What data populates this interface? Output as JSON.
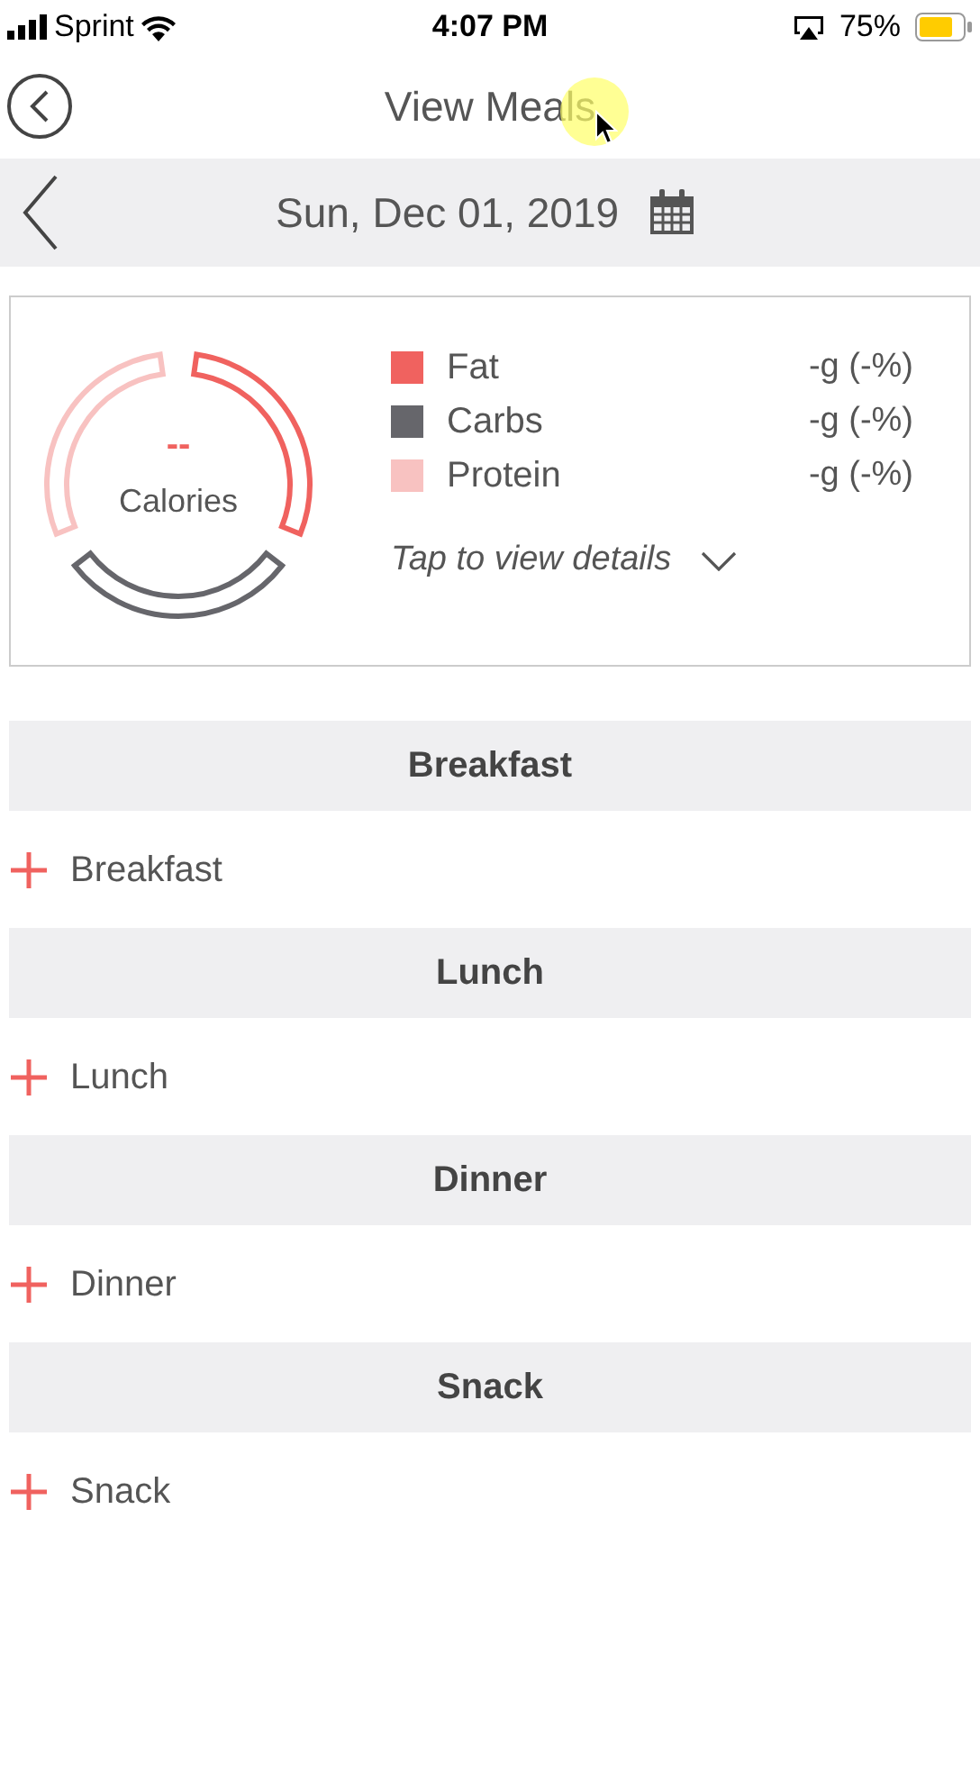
{
  "status_bar": {
    "carrier": "Sprint",
    "time": "4:07 PM",
    "battery": "75%"
  },
  "header": {
    "title": "View Meals"
  },
  "date_bar": {
    "date": "Sun, Dec 01, 2019"
  },
  "summary": {
    "calories_value": "--",
    "calories_label": "Calories",
    "macros": [
      {
        "name": "Fat",
        "value": "-g (-%)",
        "color": "#f0625f"
      },
      {
        "name": "Carbs",
        "value": "-g (-%)",
        "color": "#66666b"
      },
      {
        "name": "Protein",
        "value": "-g (-%)",
        "color": "#f8c2c1"
      }
    ],
    "details_link": "Tap to view details"
  },
  "meals": [
    {
      "heading": "Breakfast",
      "add_label": "Breakfast"
    },
    {
      "heading": "Lunch",
      "add_label": "Lunch"
    },
    {
      "heading": "Dinner",
      "add_label": "Dinner"
    },
    {
      "heading": "Snack",
      "add_label": "Snack"
    }
  ]
}
